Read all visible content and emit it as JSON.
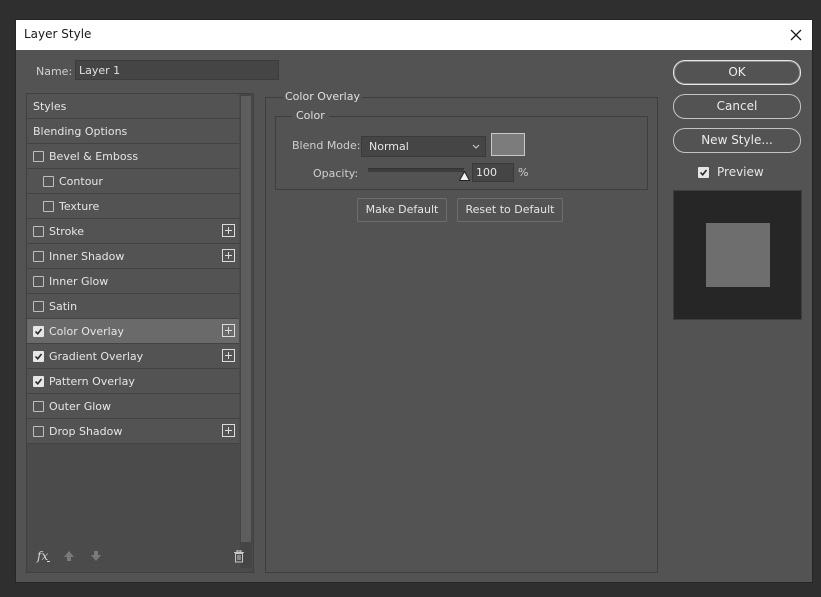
{
  "dialog": {
    "title": "Layer Style"
  },
  "name_row": {
    "label": "Name:",
    "value": "Layer 1"
  },
  "styles_panel": {
    "items": [
      {
        "label": "Styles",
        "has_checkbox": false,
        "checked": false,
        "indent": false,
        "has_plus": false,
        "selected": false
      },
      {
        "label": "Blending Options",
        "has_checkbox": false,
        "checked": false,
        "indent": false,
        "has_plus": false,
        "selected": false
      },
      {
        "label": "Bevel & Emboss",
        "has_checkbox": true,
        "checked": false,
        "indent": false,
        "has_plus": false,
        "selected": false
      },
      {
        "label": "Contour",
        "has_checkbox": true,
        "checked": false,
        "indent": true,
        "has_plus": false,
        "selected": false
      },
      {
        "label": "Texture",
        "has_checkbox": true,
        "checked": false,
        "indent": true,
        "has_plus": false,
        "selected": false
      },
      {
        "label": "Stroke",
        "has_checkbox": true,
        "checked": false,
        "indent": false,
        "has_plus": true,
        "selected": false
      },
      {
        "label": "Inner Shadow",
        "has_checkbox": true,
        "checked": false,
        "indent": false,
        "has_plus": true,
        "selected": false
      },
      {
        "label": "Inner Glow",
        "has_checkbox": true,
        "checked": false,
        "indent": false,
        "has_plus": false,
        "selected": false
      },
      {
        "label": "Satin",
        "has_checkbox": true,
        "checked": false,
        "indent": false,
        "has_plus": false,
        "selected": false
      },
      {
        "label": "Color Overlay",
        "has_checkbox": true,
        "checked": true,
        "indent": false,
        "has_plus": true,
        "selected": true
      },
      {
        "label": "Gradient Overlay",
        "has_checkbox": true,
        "checked": true,
        "indent": false,
        "has_plus": true,
        "selected": false
      },
      {
        "label": "Pattern Overlay",
        "has_checkbox": true,
        "checked": true,
        "indent": false,
        "has_plus": false,
        "selected": false
      },
      {
        "label": "Outer Glow",
        "has_checkbox": true,
        "checked": false,
        "indent": false,
        "has_plus": false,
        "selected": false
      },
      {
        "label": "Drop Shadow",
        "has_checkbox": true,
        "checked": false,
        "indent": false,
        "has_plus": true,
        "selected": false
      }
    ],
    "bottom_icons": [
      "fx-icon",
      "move-up-icon",
      "move-down-icon",
      "trash-icon"
    ]
  },
  "color_overlay": {
    "section_title": "Color Overlay",
    "group_title": "Color",
    "blend_mode_label": "Blend Mode:",
    "blend_mode_value": "Normal",
    "overlay_color": "#7c7c7c",
    "opacity_label": "Opacity:",
    "opacity_value": "100",
    "opacity_unit": "%",
    "opacity_level": 1.0,
    "make_default_label": "Make Default",
    "reset_default_label": "Reset to Default"
  },
  "right_panel": {
    "ok_label": "OK",
    "cancel_label": "Cancel",
    "new_style_label": "New Style...",
    "preview_label": "Preview",
    "preview_checked": true
  }
}
